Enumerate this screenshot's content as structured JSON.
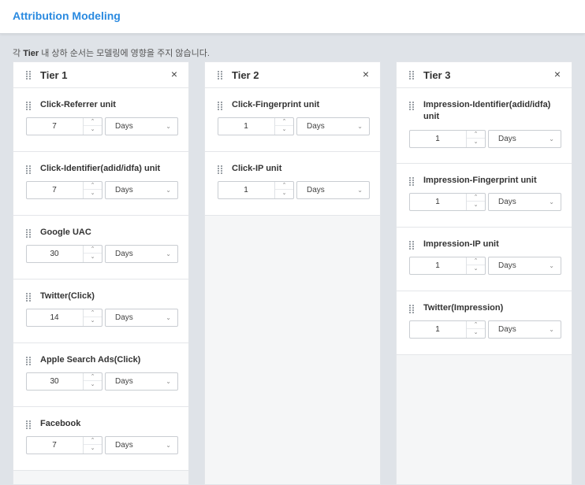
{
  "header": {
    "title": "Attribution Modeling"
  },
  "hint": {
    "prefix": "각 ",
    "bold": "Tier",
    "suffix": " 내 상하 순서는 모델링에 영향을 주지 않습니다."
  },
  "icons": {
    "drag": "drag-handle-icon",
    "close": "close-icon",
    "step_up": "chevron-up-icon",
    "step_down": "chevron-down-icon",
    "dropdown": "chevron-down-icon"
  },
  "glyphs": {
    "close": "×",
    "up": "⌃",
    "down": "⌄",
    "chevron": "⌄"
  },
  "tiers": [
    {
      "title": "Tier 1",
      "items": [
        {
          "label": "Click-Referrer unit",
          "value": "7",
          "unit": "Days"
        },
        {
          "label": "Click-Identifier(adid/idfa) unit",
          "value": "7",
          "unit": "Days"
        },
        {
          "label": "Google UAC",
          "value": "30",
          "unit": "Days"
        },
        {
          "label": "Twitter(Click)",
          "value": "14",
          "unit": "Days"
        },
        {
          "label": "Apple Search Ads(Click)",
          "value": "30",
          "unit": "Days"
        },
        {
          "label": "Facebook",
          "value": "7",
          "unit": "Days"
        }
      ]
    },
    {
      "title": "Tier 2",
      "items": [
        {
          "label": "Click-Fingerprint unit",
          "value": "1",
          "unit": "Days"
        },
        {
          "label": "Click-IP unit",
          "value": "1",
          "unit": "Days"
        }
      ]
    },
    {
      "title": "Tier 3",
      "items": [
        {
          "label": "Impression-Identifier(adid/idfa) unit",
          "value": "1",
          "unit": "Days"
        },
        {
          "label": "Impression-Fingerprint unit",
          "value": "1",
          "unit": "Days"
        },
        {
          "label": "Impression-IP unit",
          "value": "1",
          "unit": "Days"
        },
        {
          "label": "Twitter(Impression)",
          "value": "1",
          "unit": "Days"
        }
      ]
    }
  ]
}
